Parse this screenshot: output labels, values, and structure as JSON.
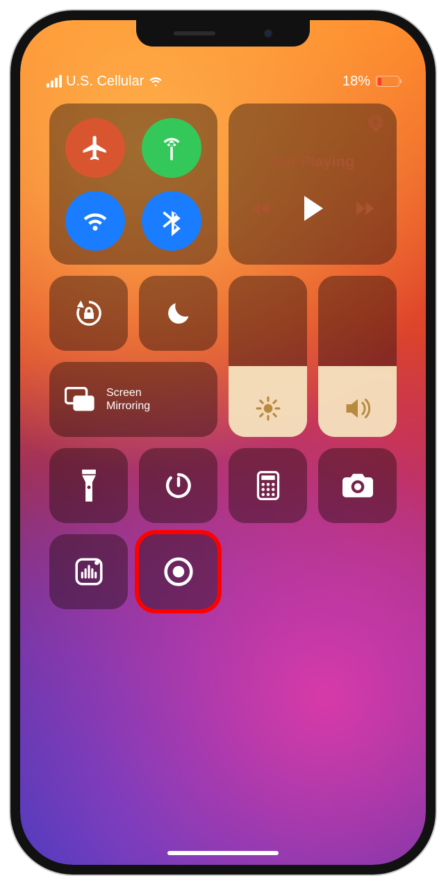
{
  "status": {
    "carrier": "U.S. Cellular",
    "battery_text": "18%",
    "battery_level_pct": 18,
    "battery_color": "#ff3b30"
  },
  "connectivity": {
    "airplane": {
      "on": false
    },
    "cellular": {
      "on": true
    },
    "wifi": {
      "on": true
    },
    "bluetooth": {
      "on": true
    }
  },
  "media": {
    "status_label": "Not Playing"
  },
  "toggles": {
    "orientation_lock": {
      "on": false
    },
    "do_not_disturb": {
      "on": false
    }
  },
  "sliders": {
    "brightness_pct": 44,
    "volume_pct": 44
  },
  "mirror": {
    "label_line1": "Screen",
    "label_line2": "Mirroring"
  },
  "shortcuts": {
    "flashlight": "flashlight-icon",
    "timer": "timer-icon",
    "calculator": "calculator-icon",
    "camera": "camera-icon",
    "ai_scan": "code-scan-icon",
    "screen_record": "record-icon"
  },
  "annotation": {
    "highlighted_tile": "screen-record-button"
  }
}
